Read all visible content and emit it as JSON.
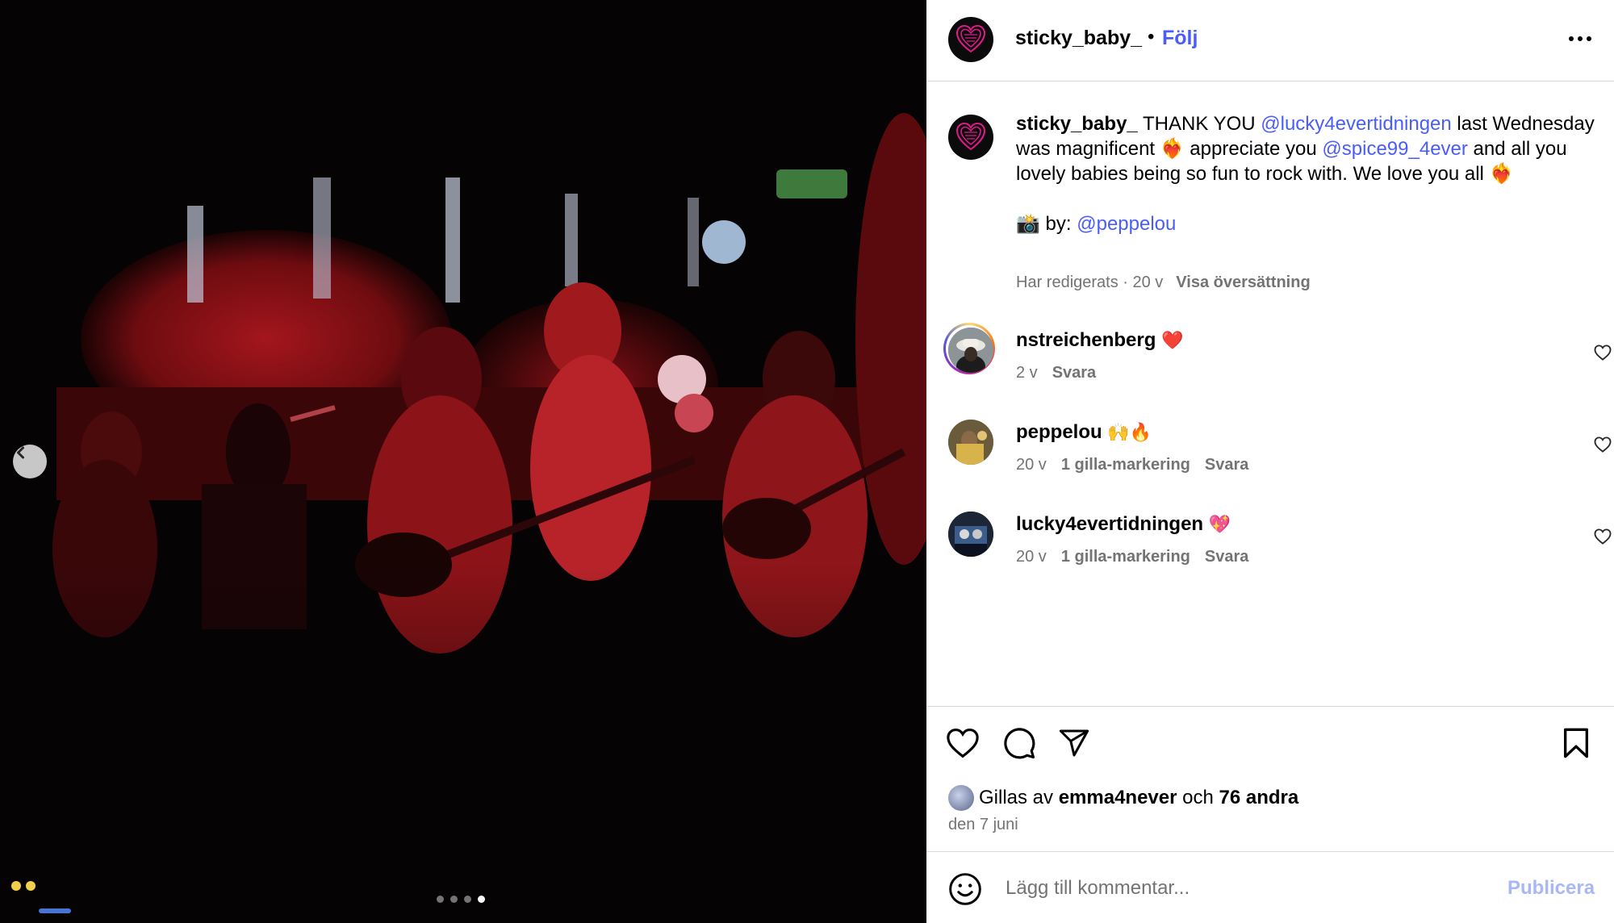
{
  "post": {
    "username": "sticky_baby_",
    "separator": "•",
    "follow_label": "Följ",
    "more_icon": "more-horizontal-icon"
  },
  "caption": {
    "username": "sticky_baby_",
    "part1": " THANK YOU ",
    "mention1": "@lucky4evertidningen",
    "part2": " last Wednesday was magnificent ❤️‍🔥 appreciate you ",
    "mention2": "@spice99_4ever",
    "part3": " and all you lovely babies being so fun to rock with. We love you all ❤️‍🔥",
    "credit_prefix": "📸 by: ",
    "credit_mention": "@peppelou",
    "edited": "Har redigerats · 20 v",
    "translate": "Visa översättning"
  },
  "comments": [
    {
      "username": "nstreichenberg",
      "text": "❤️",
      "age": "2 v",
      "likes": "",
      "reply": "Svara"
    },
    {
      "username": "peppelou",
      "text": "🙌🔥",
      "age": "20 v",
      "likes": "1 gilla-markering",
      "reply": "Svara"
    },
    {
      "username": "lucky4evertidningen",
      "text": "💖",
      "age": "20 v",
      "likes": "1 gilla-markering",
      "reply": "Svara"
    }
  ],
  "likes": {
    "prefix": "Gillas av ",
    "user": "emma4never",
    "middle": " och ",
    "others": "76 andra"
  },
  "date": "den 7 juni",
  "composer": {
    "placeholder": "Lägg till kommentar...",
    "publish_label": "Publicera"
  },
  "carousel": {
    "total": 4,
    "active_index": 4
  },
  "colors": {
    "link": "#4a5df9",
    "muted": "#737373",
    "publish_disabled": "#a8b7f7",
    "heart_red": "#ed1f35"
  }
}
